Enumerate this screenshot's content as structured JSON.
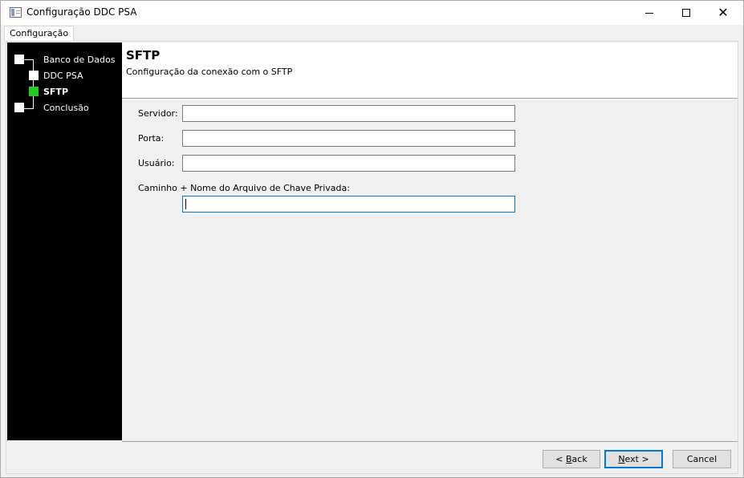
{
  "window": {
    "title": "Configuração DDC PSA",
    "minimize_symbol": "—",
    "maximize_symbol": "☐",
    "close_symbol": "✕"
  },
  "tabs": [
    {
      "label": "Configuração",
      "selected": true
    }
  ],
  "steps": [
    {
      "label": "Banco de Dados",
      "state": "pending"
    },
    {
      "label": "DDC PSA",
      "state": "pending"
    },
    {
      "label": "SFTP",
      "state": "current"
    },
    {
      "label": "Conclusão",
      "state": "pending"
    }
  ],
  "header": {
    "title": "SFTP",
    "subtitle": "Configuração da conexão com o SFTP"
  },
  "form": {
    "server_label": "Servidor:",
    "server_value": "",
    "port_label": "Porta:",
    "port_value": "",
    "user_label": "Usuário:",
    "user_value": "",
    "key_label": "Caminho + Nome do Arquivo de Chave Privada:",
    "key_value": ""
  },
  "buttons": {
    "back": "< Back",
    "back_hotkey": "B",
    "next": "Next >",
    "next_hotkey": "N",
    "cancel": "Cancel"
  },
  "colors": {
    "step_current": "#22cc22",
    "step_pending": "#ffffff",
    "navigator_bg": "#000000",
    "focus_border": "#0078d7"
  }
}
